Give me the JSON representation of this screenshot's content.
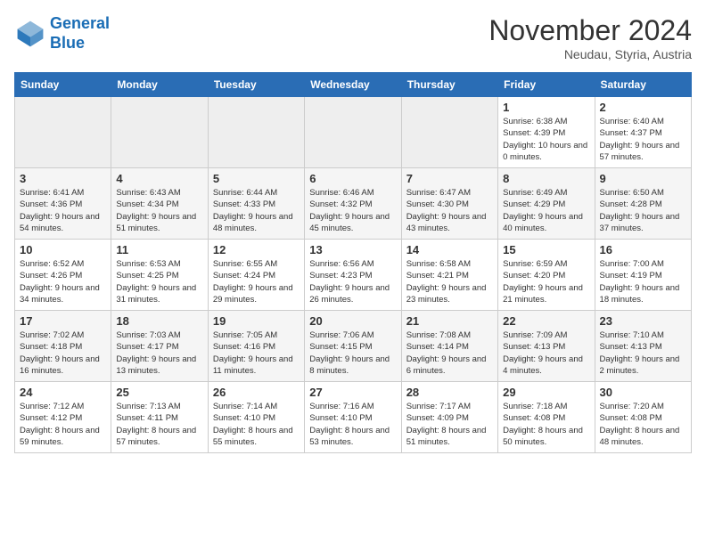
{
  "logo": {
    "line1": "General",
    "line2": "Blue"
  },
  "title": "November 2024",
  "subtitle": "Neudau, Styria, Austria",
  "days_of_week": [
    "Sunday",
    "Monday",
    "Tuesday",
    "Wednesday",
    "Thursday",
    "Friday",
    "Saturday"
  ],
  "weeks": [
    [
      {
        "day": "",
        "empty": true
      },
      {
        "day": "",
        "empty": true
      },
      {
        "day": "",
        "empty": true
      },
      {
        "day": "",
        "empty": true
      },
      {
        "day": "",
        "empty": true
      },
      {
        "day": "1",
        "sunrise": "Sunrise: 6:38 AM",
        "sunset": "Sunset: 4:39 PM",
        "daylight": "Daylight: 10 hours and 0 minutes."
      },
      {
        "day": "2",
        "sunrise": "Sunrise: 6:40 AM",
        "sunset": "Sunset: 4:37 PM",
        "daylight": "Daylight: 9 hours and 57 minutes."
      }
    ],
    [
      {
        "day": "3",
        "sunrise": "Sunrise: 6:41 AM",
        "sunset": "Sunset: 4:36 PM",
        "daylight": "Daylight: 9 hours and 54 minutes."
      },
      {
        "day": "4",
        "sunrise": "Sunrise: 6:43 AM",
        "sunset": "Sunset: 4:34 PM",
        "daylight": "Daylight: 9 hours and 51 minutes."
      },
      {
        "day": "5",
        "sunrise": "Sunrise: 6:44 AM",
        "sunset": "Sunset: 4:33 PM",
        "daylight": "Daylight: 9 hours and 48 minutes."
      },
      {
        "day": "6",
        "sunrise": "Sunrise: 6:46 AM",
        "sunset": "Sunset: 4:32 PM",
        "daylight": "Daylight: 9 hours and 45 minutes."
      },
      {
        "day": "7",
        "sunrise": "Sunrise: 6:47 AM",
        "sunset": "Sunset: 4:30 PM",
        "daylight": "Daylight: 9 hours and 43 minutes."
      },
      {
        "day": "8",
        "sunrise": "Sunrise: 6:49 AM",
        "sunset": "Sunset: 4:29 PM",
        "daylight": "Daylight: 9 hours and 40 minutes."
      },
      {
        "day": "9",
        "sunrise": "Sunrise: 6:50 AM",
        "sunset": "Sunset: 4:28 PM",
        "daylight": "Daylight: 9 hours and 37 minutes."
      }
    ],
    [
      {
        "day": "10",
        "sunrise": "Sunrise: 6:52 AM",
        "sunset": "Sunset: 4:26 PM",
        "daylight": "Daylight: 9 hours and 34 minutes."
      },
      {
        "day": "11",
        "sunrise": "Sunrise: 6:53 AM",
        "sunset": "Sunset: 4:25 PM",
        "daylight": "Daylight: 9 hours and 31 minutes."
      },
      {
        "day": "12",
        "sunrise": "Sunrise: 6:55 AM",
        "sunset": "Sunset: 4:24 PM",
        "daylight": "Daylight: 9 hours and 29 minutes."
      },
      {
        "day": "13",
        "sunrise": "Sunrise: 6:56 AM",
        "sunset": "Sunset: 4:23 PM",
        "daylight": "Daylight: 9 hours and 26 minutes."
      },
      {
        "day": "14",
        "sunrise": "Sunrise: 6:58 AM",
        "sunset": "Sunset: 4:21 PM",
        "daylight": "Daylight: 9 hours and 23 minutes."
      },
      {
        "day": "15",
        "sunrise": "Sunrise: 6:59 AM",
        "sunset": "Sunset: 4:20 PM",
        "daylight": "Daylight: 9 hours and 21 minutes."
      },
      {
        "day": "16",
        "sunrise": "Sunrise: 7:00 AM",
        "sunset": "Sunset: 4:19 PM",
        "daylight": "Daylight: 9 hours and 18 minutes."
      }
    ],
    [
      {
        "day": "17",
        "sunrise": "Sunrise: 7:02 AM",
        "sunset": "Sunset: 4:18 PM",
        "daylight": "Daylight: 9 hours and 16 minutes."
      },
      {
        "day": "18",
        "sunrise": "Sunrise: 7:03 AM",
        "sunset": "Sunset: 4:17 PM",
        "daylight": "Daylight: 9 hours and 13 minutes."
      },
      {
        "day": "19",
        "sunrise": "Sunrise: 7:05 AM",
        "sunset": "Sunset: 4:16 PM",
        "daylight": "Daylight: 9 hours and 11 minutes."
      },
      {
        "day": "20",
        "sunrise": "Sunrise: 7:06 AM",
        "sunset": "Sunset: 4:15 PM",
        "daylight": "Daylight: 9 hours and 8 minutes."
      },
      {
        "day": "21",
        "sunrise": "Sunrise: 7:08 AM",
        "sunset": "Sunset: 4:14 PM",
        "daylight": "Daylight: 9 hours and 6 minutes."
      },
      {
        "day": "22",
        "sunrise": "Sunrise: 7:09 AM",
        "sunset": "Sunset: 4:13 PM",
        "daylight": "Daylight: 9 hours and 4 minutes."
      },
      {
        "day": "23",
        "sunrise": "Sunrise: 7:10 AM",
        "sunset": "Sunset: 4:13 PM",
        "daylight": "Daylight: 9 hours and 2 minutes."
      }
    ],
    [
      {
        "day": "24",
        "sunrise": "Sunrise: 7:12 AM",
        "sunset": "Sunset: 4:12 PM",
        "daylight": "Daylight: 8 hours and 59 minutes."
      },
      {
        "day": "25",
        "sunrise": "Sunrise: 7:13 AM",
        "sunset": "Sunset: 4:11 PM",
        "daylight": "Daylight: 8 hours and 57 minutes."
      },
      {
        "day": "26",
        "sunrise": "Sunrise: 7:14 AM",
        "sunset": "Sunset: 4:10 PM",
        "daylight": "Daylight: 8 hours and 55 minutes."
      },
      {
        "day": "27",
        "sunrise": "Sunrise: 7:16 AM",
        "sunset": "Sunset: 4:10 PM",
        "daylight": "Daylight: 8 hours and 53 minutes."
      },
      {
        "day": "28",
        "sunrise": "Sunrise: 7:17 AM",
        "sunset": "Sunset: 4:09 PM",
        "daylight": "Daylight: 8 hours and 51 minutes."
      },
      {
        "day": "29",
        "sunrise": "Sunrise: 7:18 AM",
        "sunset": "Sunset: 4:08 PM",
        "daylight": "Daylight: 8 hours and 50 minutes."
      },
      {
        "day": "30",
        "sunrise": "Sunrise: 7:20 AM",
        "sunset": "Sunset: 4:08 PM",
        "daylight": "Daylight: 8 hours and 48 minutes."
      }
    ]
  ]
}
